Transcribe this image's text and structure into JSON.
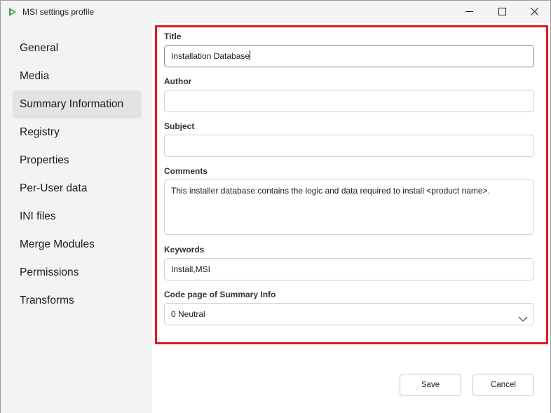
{
  "window": {
    "title": "MSI settings profile"
  },
  "sidebar": {
    "items": [
      {
        "label": "General",
        "selected": false
      },
      {
        "label": "Media",
        "selected": false
      },
      {
        "label": "Summary Information",
        "selected": true
      },
      {
        "label": "Registry",
        "selected": false
      },
      {
        "label": "Properties",
        "selected": false
      },
      {
        "label": "Per-User data",
        "selected": false
      },
      {
        "label": "INI files",
        "selected": false
      },
      {
        "label": "Merge Modules",
        "selected": false
      },
      {
        "label": "Permissions",
        "selected": false
      },
      {
        "label": "Transforms",
        "selected": false
      }
    ]
  },
  "form": {
    "title": {
      "label": "Title",
      "value": "Installation Database"
    },
    "author": {
      "label": "Author",
      "value": ""
    },
    "subject": {
      "label": "Subject",
      "value": ""
    },
    "comments": {
      "label": "Comments",
      "value": "This installer database contains the logic and data required to install <product name>."
    },
    "keywords": {
      "label": "Keywords",
      "value": "Install,MSI"
    },
    "codepage": {
      "label": "Code page of Summary Info",
      "value": "0 Neutral"
    }
  },
  "buttons": {
    "save": "Save",
    "cancel": "Cancel"
  },
  "colors": {
    "highlight_border": "#e01a22",
    "app_icon": "#3aa655",
    "selected_nav": "#e3e3e3"
  },
  "icons": {
    "app": "msi-app-icon",
    "minimize": "minimize-icon",
    "maximize": "maximize-icon",
    "close": "close-icon",
    "dropdown": "chevron-down-icon"
  }
}
